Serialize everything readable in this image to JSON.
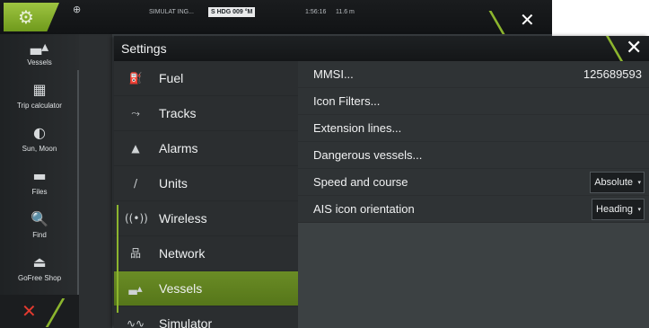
{
  "topbar": {
    "home_icon": "gear-icon",
    "globe_icon": "globe-icon",
    "sim_text": "SIMULAT ING...",
    "hdg_text": "S HDG 009 °M",
    "time_text": "1:56:16",
    "dist_text": "11.6 m",
    "close_symbol": "✕"
  },
  "sidebar": {
    "items": [
      {
        "label": "Vessels",
        "icon": "vessels-icon",
        "glyph": "▃▴"
      },
      {
        "label": "Trip calculator",
        "icon": "calculator-icon",
        "glyph": "▦"
      },
      {
        "label": "Sun, Moon",
        "icon": "sun-moon-icon",
        "glyph": "◐"
      },
      {
        "label": "Files",
        "icon": "folder-icon",
        "glyph": "▬"
      },
      {
        "label": "Find",
        "icon": "search-icon",
        "glyph": "🔍"
      },
      {
        "label": "GoFree Shop",
        "icon": "gofree-icon",
        "glyph": "⏏"
      }
    ],
    "close_symbol": "✕"
  },
  "dialog": {
    "title": "Settings",
    "close_symbol": "✕",
    "categories": [
      {
        "label": "Fuel",
        "icon": "fuel-icon",
        "glyph": "⛽"
      },
      {
        "label": "Tracks",
        "icon": "tracks-icon",
        "glyph": "⤳"
      },
      {
        "label": "Alarms",
        "icon": "alarm-bell-icon",
        "glyph": "▲"
      },
      {
        "label": "Units",
        "icon": "units-icon",
        "glyph": "/"
      },
      {
        "label": "Wireless",
        "icon": "wireless-icon",
        "glyph": "((•))"
      },
      {
        "label": "Network",
        "icon": "network-icon",
        "glyph": "品"
      },
      {
        "label": "Vessels",
        "icon": "vessels-icon",
        "glyph": "▃▴"
      },
      {
        "label": "Simulator",
        "icon": "simulator-icon",
        "glyph": "∿∿"
      }
    ],
    "selected_category": "Vessels",
    "settings": [
      {
        "label": "MMSI...",
        "value": "125689593"
      },
      {
        "label": "Icon Filters..."
      },
      {
        "label": "Extension lines..."
      },
      {
        "label": "Dangerous vessels..."
      },
      {
        "label": "Speed and course",
        "dropdown": "Absolute"
      },
      {
        "label": "AIS icon orientation",
        "dropdown": "Heading"
      }
    ],
    "dropdown_caret": "▾"
  },
  "colors": {
    "accent_green": "#8cb52e",
    "selected_green": "#6a8c25",
    "close_red": "#e33a2f"
  }
}
